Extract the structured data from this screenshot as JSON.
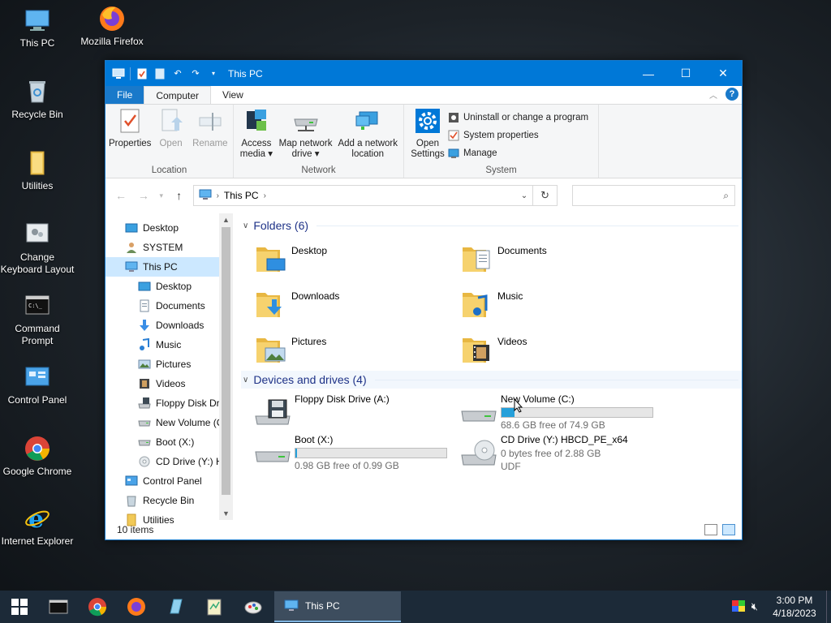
{
  "desktop": {
    "icons": [
      {
        "label": "This PC"
      },
      {
        "label": "Mozilla Firefox"
      },
      {
        "label": "Recycle Bin"
      },
      {
        "label": "Utilities"
      },
      {
        "label": "Change Keyboard Layout"
      },
      {
        "label": "Command Prompt"
      },
      {
        "label": "Control Panel"
      },
      {
        "label": "Google Chrome"
      },
      {
        "label": "Internet Explorer"
      }
    ]
  },
  "window": {
    "title": "This PC",
    "ribbon_tabs": [
      "File",
      "Computer",
      "View"
    ],
    "ribbon": {
      "location": {
        "label": "Location",
        "properties": "Properties",
        "open": "Open",
        "rename": "Rename"
      },
      "network": {
        "label": "Network",
        "access_media_1": "Access",
        "access_media_2": "media ▾",
        "map_drive_1": "Map network",
        "map_drive_2": "drive ▾",
        "add_location_1": "Add a network",
        "add_location_2": "location"
      },
      "system": {
        "label": "System",
        "open_settings_1": "Open",
        "open_settings_2": "Settings",
        "uninstall": "Uninstall or change a program",
        "system_properties": "System properties",
        "manage": "Manage"
      }
    },
    "address": {
      "path": "This PC",
      "search_placeholder": ""
    },
    "nav_items": [
      {
        "label": "Desktop",
        "indent": 1
      },
      {
        "label": "SYSTEM",
        "indent": 1
      },
      {
        "label": "This PC",
        "indent": 1
      },
      {
        "label": "Desktop",
        "indent": 2
      },
      {
        "label": "Documents",
        "indent": 2
      },
      {
        "label": "Downloads",
        "indent": 2
      },
      {
        "label": "Music",
        "indent": 2
      },
      {
        "label": "Pictures",
        "indent": 2
      },
      {
        "label": "Videos",
        "indent": 2
      },
      {
        "label": "Floppy Disk Dri",
        "indent": 2
      },
      {
        "label": "New Volume (C",
        "indent": 2
      },
      {
        "label": "Boot (X:)",
        "indent": 2
      },
      {
        "label": "CD Drive (Y:) H",
        "indent": 2
      },
      {
        "label": "Control Panel",
        "indent": 1
      },
      {
        "label": "Recycle Bin",
        "indent": 1
      },
      {
        "label": "Utilities",
        "indent": 1
      }
    ],
    "folders_header": "Folders (6)",
    "folders": [
      "Desktop",
      "Documents",
      "Downloads",
      "Music",
      "Pictures",
      "Videos"
    ],
    "drives_header": "Devices and drives (4)",
    "drives": {
      "floppy": {
        "name": "Floppy Disk Drive (A:)"
      },
      "c": {
        "name": "New Volume (C:)",
        "free": "68.6 GB free of 74.9 GB",
        "used_fraction": 0.084
      },
      "boot": {
        "name": "Boot (X:)",
        "free": "0.98 GB free of 0.99 GB",
        "used_fraction": 0.01
      },
      "cd": {
        "name": "CD Drive (Y:) HBCD_PE_x64",
        "free": "0 bytes free of 2.88 GB",
        "fs": "UDF"
      }
    },
    "status": "10 items"
  },
  "taskbar": {
    "active_task": "This PC",
    "time": "3:00 PM",
    "date": "4/18/2023"
  },
  "colors": {
    "accent": "#0078d7",
    "selection": "#cce8ff",
    "drive_bar": "#26a0da",
    "group_header": "#1e3287"
  }
}
